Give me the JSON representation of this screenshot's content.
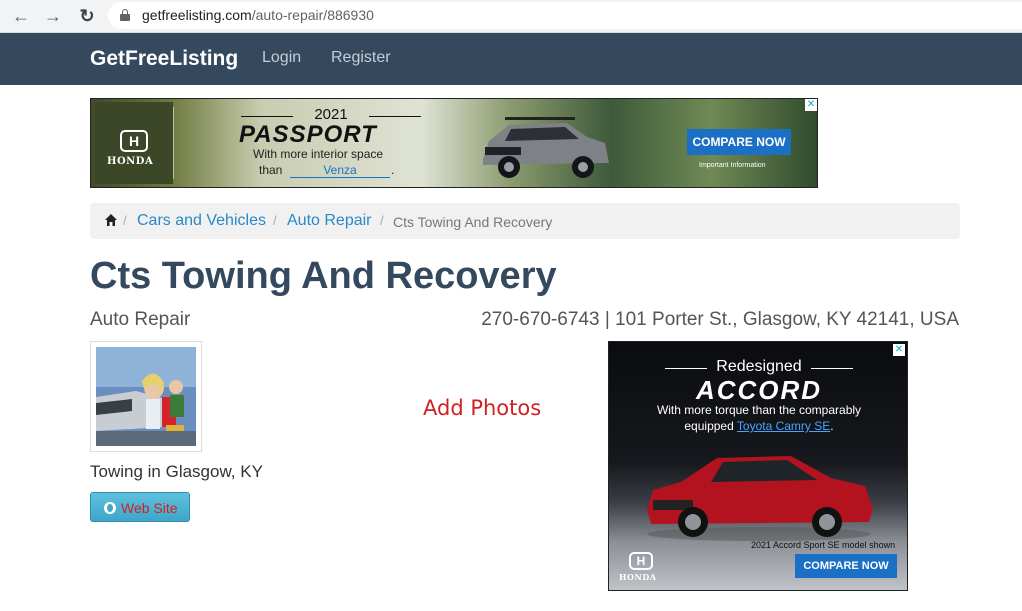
{
  "browser": {
    "url_domain": "getfreelisting.com",
    "url_path": "/auto-repair/886930"
  },
  "navbar": {
    "brand": "GetFreeListing",
    "links": [
      "Login",
      "Register"
    ]
  },
  "ad_top": {
    "brand": "HONDA",
    "year": "2021",
    "model": "PASSPORT",
    "line1": "With more interior space",
    "than": "than",
    "compare_link": "Venza",
    "period": ".",
    "cta": "COMPARE NOW",
    "important": "Important Information"
  },
  "breadcrumb": {
    "items": [
      "Cars and Vehicles",
      "Auto Repair"
    ],
    "separator": "/",
    "current": "Cts Towing And Recovery"
  },
  "listing": {
    "title": "Cts Towing And Recovery",
    "category": "Auto Repair",
    "contact": "270-670-6743 | 101 Porter St., Glasgow, KY 42141, USA",
    "add_photos": "Add Photos",
    "tagline": "Towing in Glasgow, KY",
    "website_button": "Web Site"
  },
  "ad_side": {
    "headline": "Redesigned",
    "model": "ACCORD",
    "line1": "With more torque than the comparably",
    "line2_prefix": "equipped",
    "line2_link": "Toyota Camry SE",
    "line2_suffix": ".",
    "model_shown": "2021 Accord Sport SE model shown",
    "brand": "HONDA",
    "cta": "COMPARE NOW"
  },
  "colors": {
    "navbar_bg": "#34495e",
    "link": "#2a88c8",
    "title": "#34495e",
    "accent_red": "#d21f1f",
    "cta_blue": "#1b6fc4"
  }
}
